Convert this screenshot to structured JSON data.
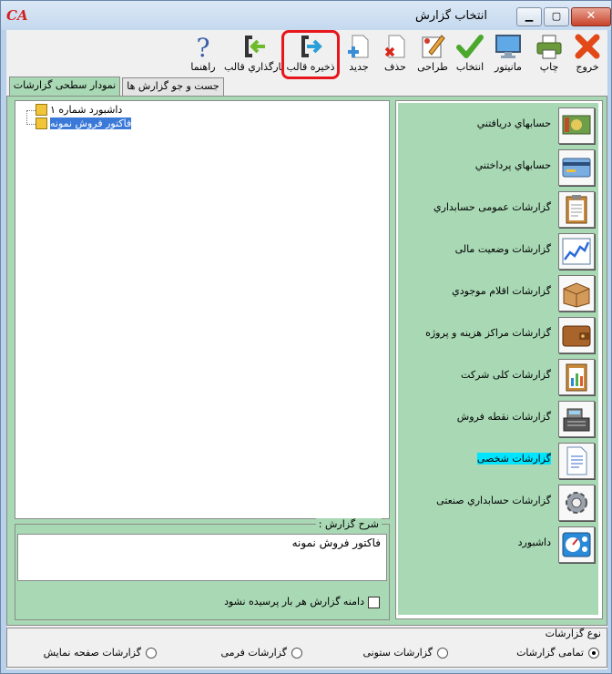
{
  "window": {
    "title": "انتخاب گزارش",
    "logo": "CA"
  },
  "toolbar": [
    {
      "key": "exit",
      "label": "خروج",
      "icon": "close-x-icon"
    },
    {
      "key": "print",
      "label": "چاپ",
      "icon": "printer-icon"
    },
    {
      "key": "monitor",
      "label": "مانیتور",
      "icon": "monitor-icon"
    },
    {
      "key": "select",
      "label": "انتخاب",
      "icon": "checkmark-icon"
    },
    {
      "key": "design",
      "label": "طراحی",
      "icon": "design-pencil-icon"
    },
    {
      "key": "delete",
      "label": "حذف",
      "icon": "delete-doc-icon"
    },
    {
      "key": "new",
      "label": "جدید",
      "icon": "new-doc-icon"
    },
    {
      "key": "save_template",
      "label": "ذخیره قالب",
      "icon": "save-template-icon"
    },
    {
      "key": "load_template",
      "label": "بارگذاري قالب",
      "icon": "load-template-icon"
    },
    {
      "key": "help",
      "label": "راهنما",
      "icon": "help-question-icon"
    }
  ],
  "tabs": [
    {
      "label": "نمودار سطحی گزارشات",
      "active": true
    },
    {
      "label": "جست و جو گزارش ها",
      "active": false
    }
  ],
  "tree": [
    {
      "label": "داشبورد شماره ۱",
      "selected": false
    },
    {
      "label": "فاکتور فروش نمونه",
      "selected": true
    }
  ],
  "description": {
    "label": "شرح گزارش :",
    "text": "فاکتور فروش نمونه",
    "checkbox_label": "دامنه گزارش هر بار پرسیده نشود",
    "checked": false
  },
  "categories": [
    {
      "label": "حسابهاي دريافتني",
      "icon": "receivables-icon"
    },
    {
      "label": "حسابهاي پرداختني",
      "icon": "payables-card-icon"
    },
    {
      "label": "گزارشات عمومی حسابداري",
      "icon": "clipboard-icon"
    },
    {
      "label": "گزارشات وضعيت مالی",
      "icon": "chart-line-icon"
    },
    {
      "label": "گزارشات اقلام موجودي",
      "icon": "inventory-box-icon"
    },
    {
      "label": "گزارشات مراكز هزينه و پروژه",
      "icon": "wallet-icon"
    },
    {
      "label": "گزارشات كلی شركت",
      "icon": "company-report-icon"
    },
    {
      "label": "گزارشات نقطه فروش",
      "icon": "cash-register-icon"
    },
    {
      "label": "گزارشات شخصی",
      "icon": "personal-doc-icon",
      "highlighted": true
    },
    {
      "label": "گزارشات حسابداري صنعتی",
      "icon": "gear-icon"
    },
    {
      "label": "داشبورد",
      "icon": "dashboard-icon"
    }
  ],
  "report_type": {
    "label": "نوع گزارشات",
    "options": [
      {
        "label": "تمامی گزارشات",
        "selected": true
      },
      {
        "label": "گزارشات ستونی",
        "selected": false
      },
      {
        "label": "گزارشات فرمی",
        "selected": false
      },
      {
        "label": "گزارشات صفحه نمایش",
        "selected": false
      }
    ]
  },
  "colors": {
    "panel_green": "#a8d8b4",
    "highlight_red": "#e8161c",
    "selection_blue": "#3b79d8",
    "cyan_highlight": "#00e4ff"
  }
}
